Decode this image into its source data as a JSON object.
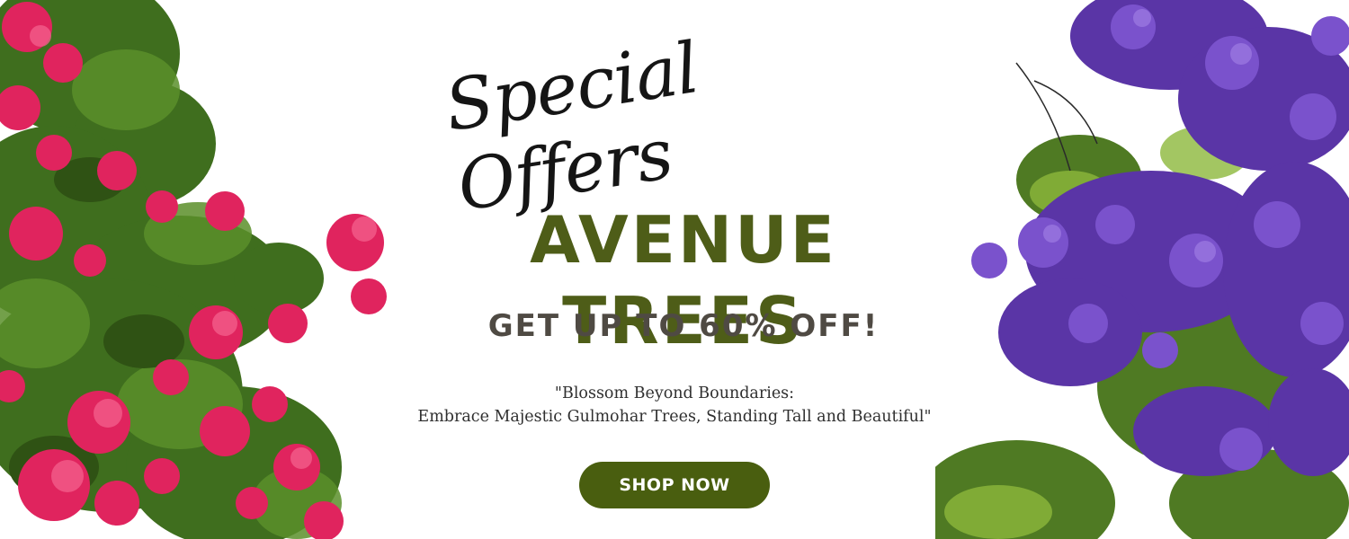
{
  "banner": {
    "script_heading": "Special Offers",
    "title": "AVENUE TREES",
    "discount": "GET UP TO 60% OFF!",
    "tagline_line1": "\"Blossom Beyond Boundaries:",
    "tagline_line2": "Embrace Majestic Gulmohar Trees, Standing Tall and Beautiful\"",
    "cta_label": "SHOP NOW"
  },
  "colors": {
    "title": "#4e5d18",
    "cta_background": "#495e0f",
    "discount_text": "#4f4a43",
    "left_blossom": "#e0245e",
    "right_blossom": "#6a3fb5",
    "foliage": "#4f7a23"
  },
  "images": {
    "left": "pink-flowering-tree-image",
    "right": "purple-jacaranda-tree-image"
  }
}
